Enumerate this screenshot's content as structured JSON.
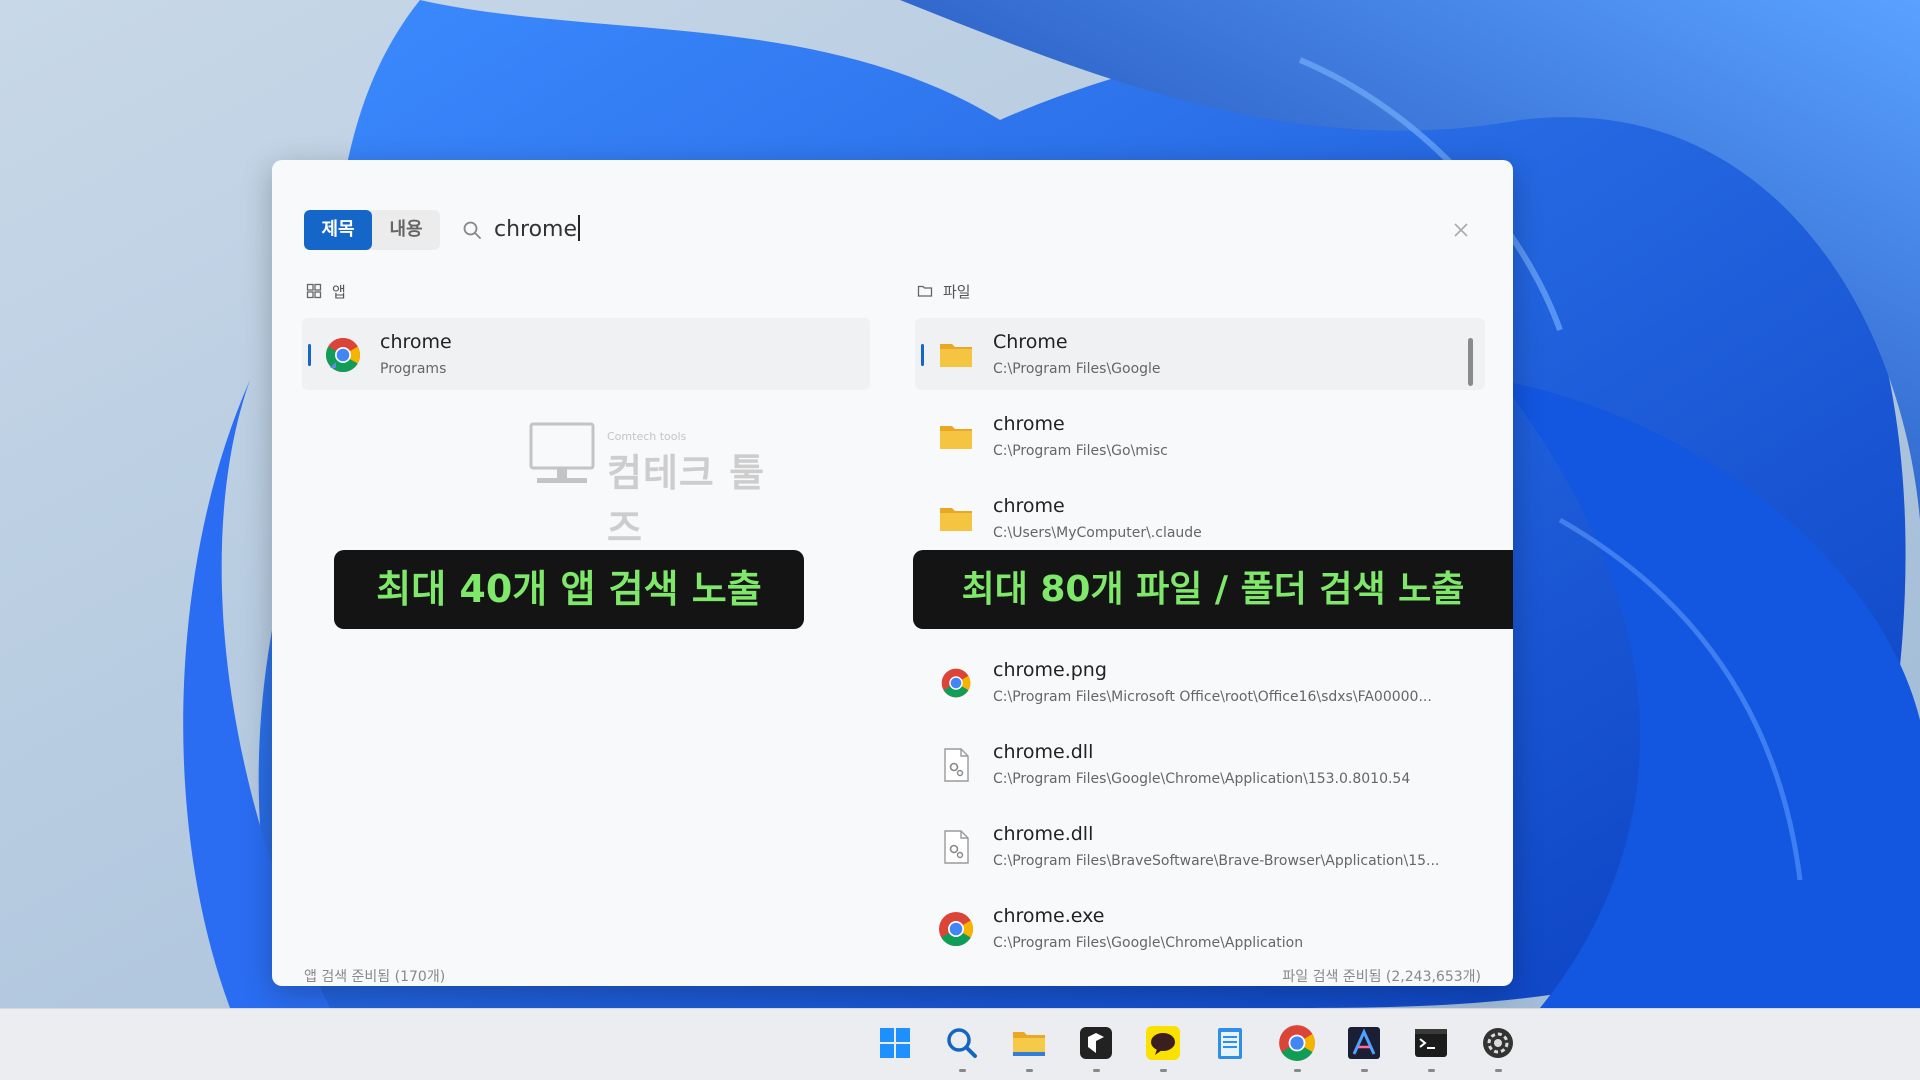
{
  "search": {
    "tab_title": "제목",
    "tab_content": "내용",
    "query": "chrome"
  },
  "apps": {
    "header": "앱",
    "items": [
      {
        "title": "chrome",
        "subtitle": "Programs",
        "icon": "chrome-icon"
      }
    ],
    "status": "앱 검색 준비됨 (170개)"
  },
  "files": {
    "header": "파일",
    "items": [
      {
        "title": "Chrome",
        "subtitle": "C:\\Program Files\\Google",
        "icon": "folder-icon"
      },
      {
        "title": "chrome",
        "subtitle": "C:\\Program Files\\Go\\misc",
        "icon": "folder-icon"
      },
      {
        "title": "chrome",
        "subtitle": "C:\\Users\\MyComputer\\.claude",
        "icon": "folder-icon"
      },
      {
        "title": "",
        "subtitle": "",
        "icon": "hidden"
      },
      {
        "title": "chrome.png",
        "subtitle": "C:\\Program Files\\Microsoft Office\\root\\Office16\\sdxs\\FA00000...",
        "icon": "chrome-icon"
      },
      {
        "title": "chrome.dll",
        "subtitle": "C:\\Program Files\\Google\\Chrome\\Application\\153.0.8010.54",
        "icon": "dll-icon"
      },
      {
        "title": "chrome.dll",
        "subtitle": "C:\\Program Files\\BraveSoftware\\Brave-Browser\\Application\\15...",
        "icon": "dll-icon"
      },
      {
        "title": "chrome.exe",
        "subtitle": "C:\\Program Files\\Google\\Chrome\\Application",
        "icon": "chrome-icon"
      }
    ],
    "status": "파일 검색 준비됨 (2,243,653개)"
  },
  "watermark": {
    "small": "Comtech tools",
    "big": "컴테크 툴즈"
  },
  "banners": {
    "apps": "최대 40개 앱 검색 노출",
    "files": "최대 80개 파일 / 폴더 검색 노출"
  },
  "taskbar": {
    "icons": [
      "windows-start-icon",
      "search-icon",
      "file-explorer-icon",
      "app-box-icon",
      "kakaotalk-icon",
      "notepad-icon",
      "chrome-icon",
      "editor-icon",
      "terminal-icon",
      "settings-icon"
    ]
  },
  "colors": {
    "accent": "#1467c8",
    "banner_bg": "#141414",
    "banner_text": "#7fe76a",
    "folder": "#f5c542"
  }
}
